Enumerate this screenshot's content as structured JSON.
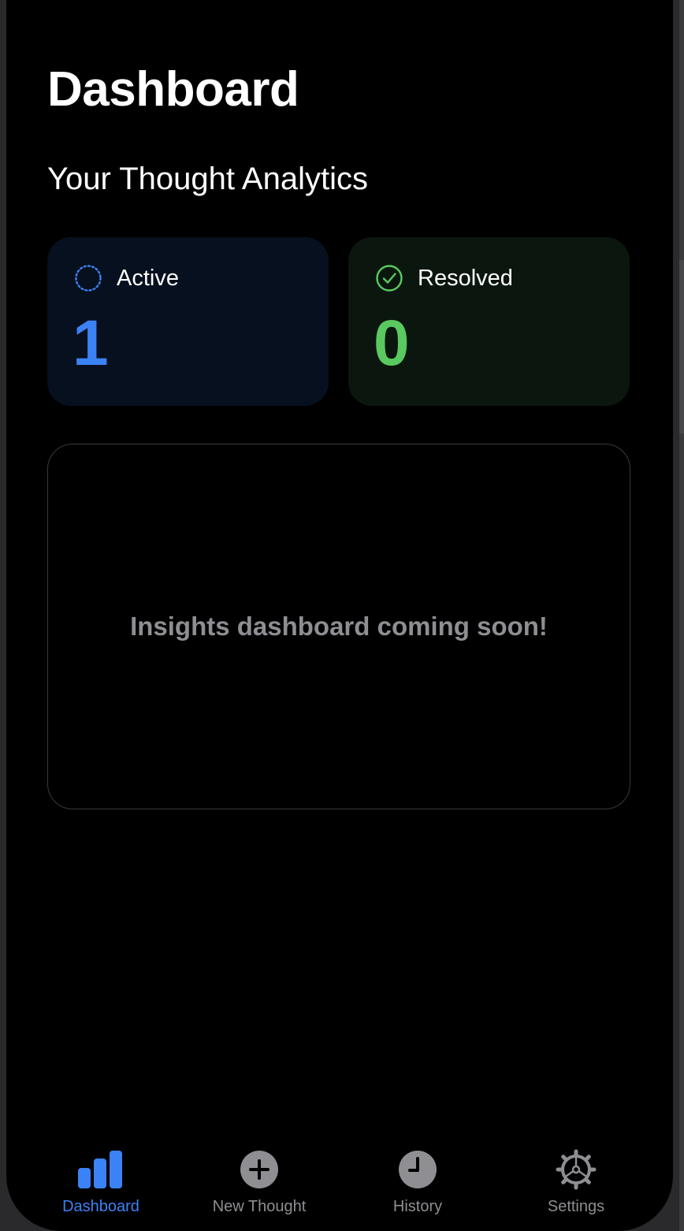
{
  "header": {
    "title": "Dashboard",
    "subtitle": "Your Thought Analytics"
  },
  "stats": {
    "active": {
      "label": "Active",
      "value": "1",
      "icon": "dotted-circle-icon",
      "color": "#3b82f6"
    },
    "resolved": {
      "label": "Resolved",
      "value": "0",
      "icon": "check-circle-icon",
      "color": "#5ac95f"
    }
  },
  "insights": {
    "message": "Insights dashboard coming soon!"
  },
  "tab_bar": {
    "selected": "Dashboard",
    "tabs": [
      {
        "label": "Dashboard",
        "icon": "bar-chart-icon"
      },
      {
        "label": "New Thought",
        "icon": "plus-circle-icon"
      },
      {
        "label": "History",
        "icon": "clock-icon"
      },
      {
        "label": "Settings",
        "icon": "gear-icon"
      }
    ]
  },
  "colors": {
    "accent": "#3b82f6",
    "success": "#5ac95f",
    "inactive": "#8e8e93",
    "background": "#000000"
  }
}
